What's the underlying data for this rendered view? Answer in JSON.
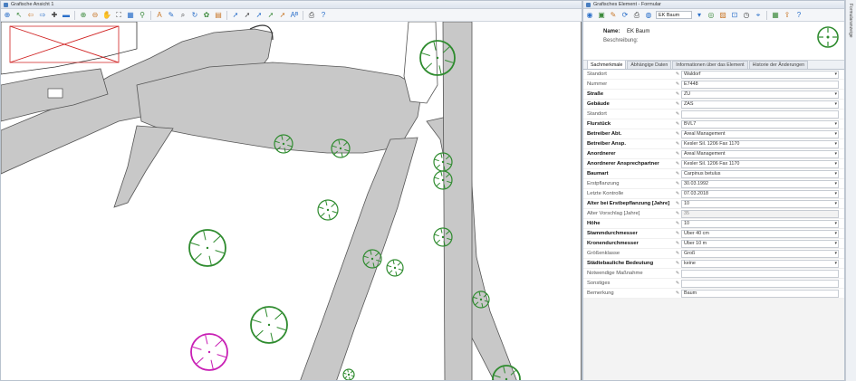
{
  "map_window": {
    "title": "Grafische Ansicht 1",
    "toolbar_icons": [
      "pointer-icon",
      "select-arrow-icon",
      "back-arrow-icon",
      "forward-arrow-icon",
      "zoom-in-plus-icon",
      "zoom-out-minus-icon",
      "zoom-in-icon",
      "zoom-out-icon",
      "pan-hand-icon",
      "zoom-extent-icon",
      "layer-icon",
      "measure-icon",
      "text-icon",
      "edit-icon",
      "search-map-icon",
      "rotate-icon",
      "paint-icon",
      "layer-props-icon",
      "arrow-tool-a-icon",
      "arrow-tool-b-icon",
      "arrow-tool-c-icon",
      "arrow-tool-d-icon",
      "arrow-tool-e-icon",
      "label-icon",
      "print-icon",
      "help-icon"
    ]
  },
  "form_window": {
    "title": "Grafisches Element - Formular",
    "toolbar": {
      "view_select": "EK Baum",
      "icons": [
        "record-icon",
        "save-icon",
        "edit-pen-icon",
        "refresh-icon",
        "print-icon",
        "globe-icon",
        "view-select-icon",
        "target-icon",
        "image-icon",
        "zoom-to-icon",
        "history-icon",
        "locate-icon",
        "table-icon",
        "export-icon",
        "help-icon"
      ]
    },
    "name_label": "Name:",
    "name_value": "EK Baum",
    "description_label": "Beschreibung:",
    "tabs": [
      {
        "label": "Sachmerkmale",
        "active": true
      },
      {
        "label": "Abhängige Daten",
        "active": false
      },
      {
        "label": "Informationen über das Element",
        "active": false
      },
      {
        "label": "Historie der Änderungen",
        "active": false
      }
    ],
    "fields": [
      {
        "label": "Standort",
        "value": "Waldorf",
        "style": "plain",
        "kind": "dropdown",
        "ro": false
      },
      {
        "label": "Nummer",
        "value": "E7448",
        "style": "plain",
        "kind": "text",
        "ro": false
      },
      {
        "label": "Straße",
        "value": "ZU",
        "style": "bold",
        "kind": "dropdown",
        "ro": false
      },
      {
        "label": "Gebäude",
        "value": "ZAS",
        "style": "bold",
        "kind": "dropdown",
        "ro": false
      },
      {
        "label": "Standort",
        "value": "",
        "style": "plain",
        "kind": "text",
        "ro": false
      },
      {
        "label": "Flurstück",
        "value": "BVL7",
        "style": "bold",
        "kind": "dropdown",
        "ro": false
      },
      {
        "label": "Betreiber Abt.",
        "value": "Areal Management",
        "style": "bold",
        "kind": "dropdown",
        "ro": false
      },
      {
        "label": "Betreiber Ansp.",
        "value": "Kesler Sil. 1206 Fax 1170",
        "style": "bold",
        "kind": "dropdown",
        "ro": false
      },
      {
        "label": "Anordnerer",
        "value": "Areal Management",
        "style": "bold",
        "kind": "dropdown",
        "ro": false
      },
      {
        "label": "Anordnerer Ansprechpartner",
        "value": "Kesler Sil. 1206 Fax 1170",
        "style": "bold",
        "kind": "dropdown",
        "ro": false
      },
      {
        "label": "Baumart",
        "value": "Carpinus betulus",
        "style": "bold",
        "kind": "dropdown",
        "ro": false
      },
      {
        "label": "Erstpflanzung",
        "value": "30.03.1992",
        "style": "plain",
        "kind": "dropdown",
        "ro": false
      },
      {
        "label": "Letzte Kontrolle",
        "value": "07.03.2018",
        "style": "plain",
        "kind": "dropdown",
        "ro": false
      },
      {
        "label": "Alter bei Erstbepflanzung [Jahre]",
        "value": "10",
        "style": "bold",
        "kind": "dropdown",
        "ro": false
      },
      {
        "label": "Alter Vorschlag [Jahre]",
        "value": "35",
        "style": "plain",
        "kind": "text",
        "ro": true
      },
      {
        "label": "Höhe",
        "value": "10",
        "style": "bold",
        "kind": "dropdown",
        "ro": false
      },
      {
        "label": "Stammdurchmesser",
        "value": "Über 40 cm",
        "style": "bold",
        "kind": "dropdown",
        "ro": false
      },
      {
        "label": "Kronendurchmesser",
        "value": "Über 10 m",
        "style": "bold",
        "kind": "dropdown",
        "ro": false
      },
      {
        "label": "Größenklasse",
        "value": "Groß",
        "style": "plain",
        "kind": "dropdown",
        "ro": false
      },
      {
        "label": "Städtebauliche Bedeutung",
        "value": "keine",
        "style": "bold",
        "kind": "dropdown",
        "ro": false
      },
      {
        "label": "Notwendige Maßnahme",
        "value": "",
        "style": "plain",
        "kind": "text",
        "ro": false
      },
      {
        "label": "Sonstiges",
        "value": "",
        "style": "plain",
        "kind": "text",
        "ro": false
      },
      {
        "label": "Bemerkung",
        "value": "Baum",
        "style": "plain",
        "kind": "text",
        "ro": false
      }
    ]
  },
  "side_panel_label": "Formularanzeige",
  "map": {
    "tree_color": "#2e8b2e",
    "highlight_color": "#c81eb4",
    "road_color": "#c8c8c8"
  }
}
